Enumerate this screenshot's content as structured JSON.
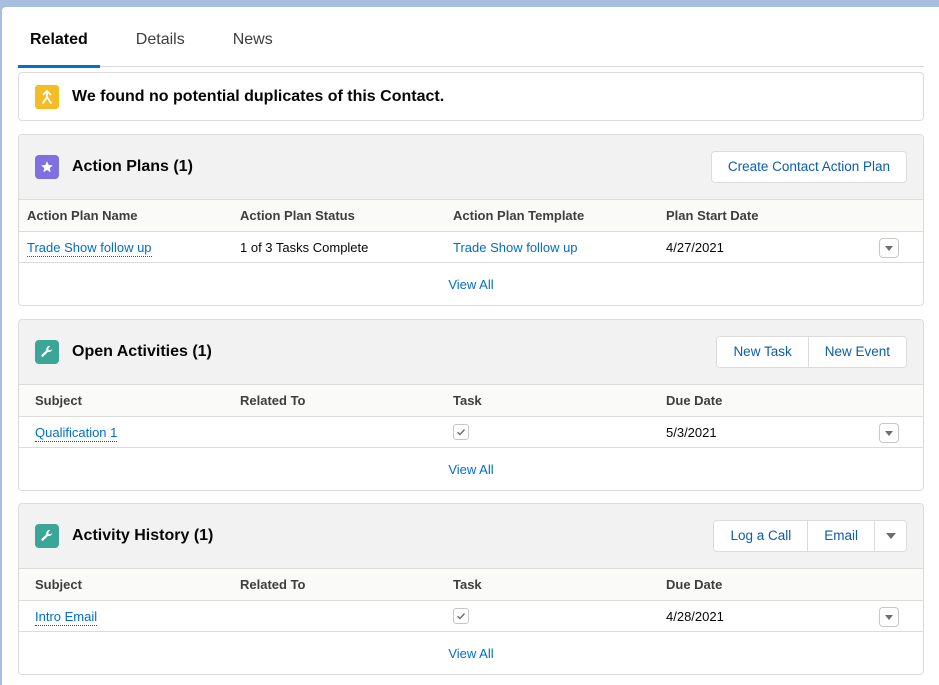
{
  "tabs": [
    {
      "label": "Related",
      "active": true
    },
    {
      "label": "Details",
      "active": false
    },
    {
      "label": "News",
      "active": false
    }
  ],
  "duplicates": {
    "icon": "merge-icon",
    "message": "We found no potential duplicates of this Contact."
  },
  "action_plans": {
    "icon": "star-icon",
    "icon_color": "#7f6fe0",
    "title": "Action Plans (1)",
    "buttons": [
      "Create Contact Action Plan"
    ],
    "columns": [
      "Action Plan Name",
      "Action Plan Status",
      "Action Plan Template",
      "Plan Start Date"
    ],
    "rows": [
      {
        "name": "Trade Show follow up",
        "status": "1 of 3 Tasks Complete",
        "template": "Trade Show follow up",
        "start_date": "4/27/2021"
      }
    ],
    "view_all": "View All"
  },
  "open_activities": {
    "icon": "wrench-icon",
    "icon_color": "#3ba597",
    "title": "Open Activities (1)",
    "buttons": [
      "New Task",
      "New Event"
    ],
    "columns": [
      "Subject",
      "Related To",
      "Task",
      "Due Date"
    ],
    "rows": [
      {
        "subject": "Qualification 1",
        "related_to": "",
        "task": true,
        "due_date": "5/3/2021"
      }
    ],
    "view_all": "View All"
  },
  "activity_history": {
    "icon": "wrench-icon",
    "icon_color": "#3ba597",
    "title": "Activity History (1)",
    "buttons": [
      "Log a Call",
      "Email"
    ],
    "columns": [
      "Subject",
      "Related To",
      "Task",
      "Due Date"
    ],
    "rows": [
      {
        "subject": "Intro Email",
        "related_to": "",
        "task": true,
        "due_date": "4/28/2021"
      }
    ],
    "view_all": "View All"
  },
  "colors": {
    "accent": "#0070d2",
    "link": "#006dcc",
    "duplicate_icon": "#f4bc25"
  }
}
